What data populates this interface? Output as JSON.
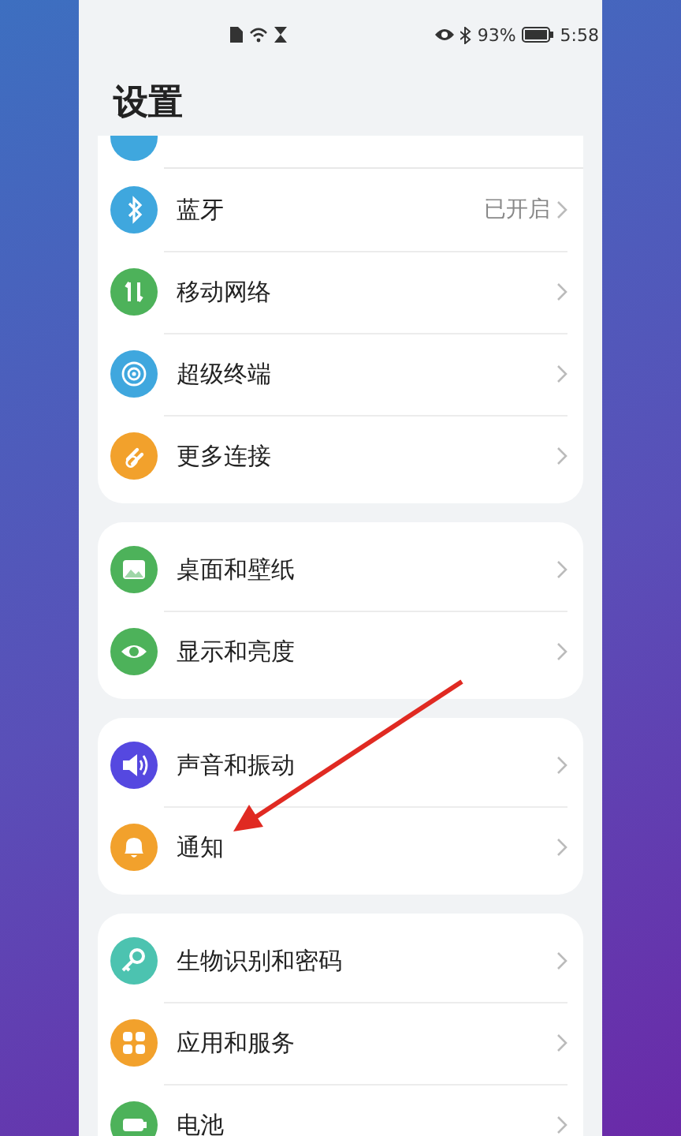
{
  "status_bar": {
    "battery_percent": "93%",
    "time": "5:58"
  },
  "title": "设置",
  "groups": [
    {
      "cut_top": true,
      "items": [
        {
          "label": "蓝牙",
          "value": "已开启",
          "color": "#3fa7de"
        },
        {
          "label": "移动网络",
          "color": "#4db25a"
        },
        {
          "label": "超级终端",
          "color": "#3fa7de"
        },
        {
          "label": "更多连接",
          "color": "#f2a12c"
        }
      ]
    },
    {
      "cut_top": false,
      "items": [
        {
          "label": "桌面和壁纸",
          "color": "#4db25a"
        },
        {
          "label": "显示和亮度",
          "color": "#4db25a"
        }
      ]
    },
    {
      "cut_top": false,
      "items": [
        {
          "label": "声音和振动",
          "color": "#5548e0"
        },
        {
          "label": "通知",
          "color": "#f2a12c"
        }
      ]
    },
    {
      "cut_top": false,
      "items": [
        {
          "label": "生物识别和密码",
          "color": "#4cc3b0"
        },
        {
          "label": "应用和服务",
          "color": "#f2a12c"
        },
        {
          "label": "电池",
          "color": "#4db25a"
        }
      ]
    }
  ],
  "annotation_arrow": true
}
